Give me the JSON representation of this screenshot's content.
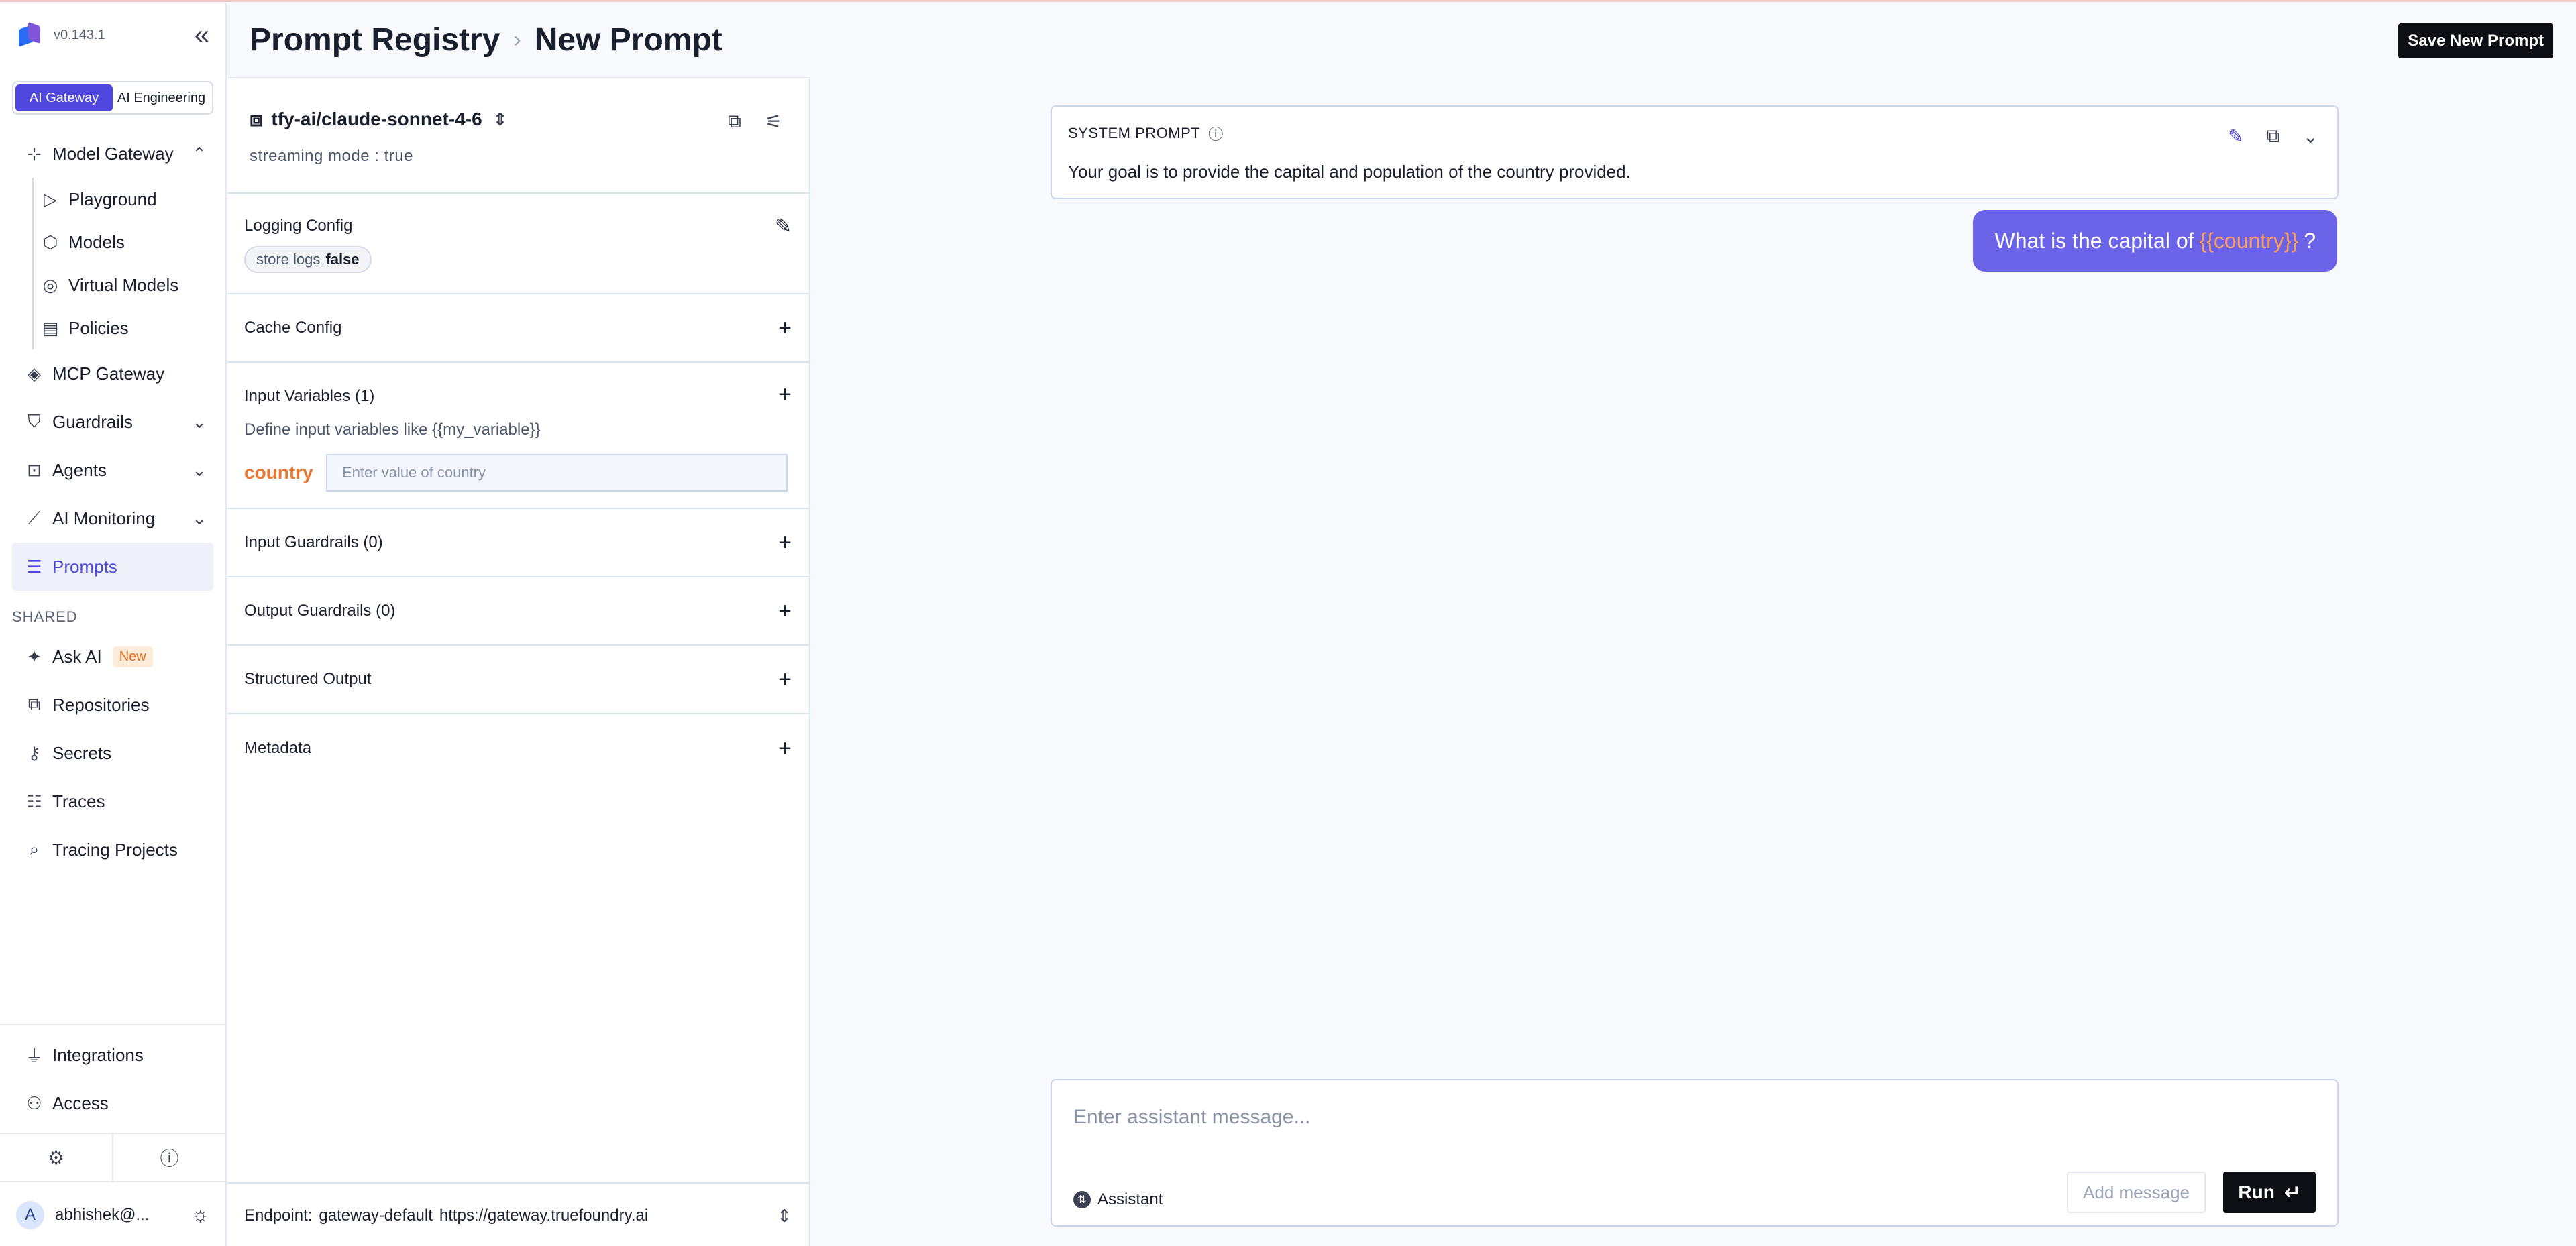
{
  "app": {
    "version": "v0.143.1",
    "segments": [
      "AI Gateway",
      "AI Engineering"
    ]
  },
  "nav": {
    "model_gateway": "Model Gateway",
    "sub": [
      "Playground",
      "Models",
      "Virtual Models",
      "Policies"
    ],
    "mcp_gateway": "MCP Gateway",
    "guardrails": "Guardrails",
    "agents": "Agents",
    "ai_monitoring": "AI Monitoring",
    "prompts": "Prompts",
    "shared_label": "SHARED",
    "ask_ai": "Ask AI",
    "new_badge": "New",
    "repositories": "Repositories",
    "secrets": "Secrets",
    "traces": "Traces",
    "tracing_projects": "Tracing Projects",
    "integrations": "Integrations",
    "access": "Access",
    "user": "abhishek@...",
    "avatar_letter": "A"
  },
  "header": {
    "breadcrumb_root": "Prompt Registry",
    "breadcrumb_current": "New Prompt",
    "save_label": "Save New Prompt"
  },
  "config": {
    "model": "tfy-ai/claude-sonnet-4-6",
    "streaming": "streaming mode : true",
    "logging_title": "Logging Config",
    "store_logs_key": "store logs",
    "store_logs_val": "false",
    "cache_title": "Cache Config",
    "input_vars_title": "Input Variables (1)",
    "input_vars_hint": "Define input variables like {{my_variable}}",
    "var_name": "country",
    "var_placeholder": "Enter value of country",
    "input_guardrails": "Input Guardrails (0)",
    "output_guardrails": "Output Guardrails (0)",
    "structured_output": "Structured Output",
    "metadata": "Metadata",
    "endpoint_label": "Endpoint:",
    "endpoint_name": "gateway-default",
    "endpoint_url": "https://gateway.truefoundry.ai"
  },
  "chat": {
    "system_label": "SYSTEM PROMPT",
    "system_text": "Your goal is to provide the capital and population of the country provided.",
    "user_prefix": "What is the capital of",
    "user_var": "{{country}}",
    "user_suffix": "?",
    "composer_placeholder": "Enter assistant message...",
    "role": "Assistant",
    "add_message": "Add message",
    "run": "Run"
  },
  "colors": {
    "accent": "#4e46dd",
    "bubble": "#6b63e8",
    "variable": "#e8762f"
  }
}
